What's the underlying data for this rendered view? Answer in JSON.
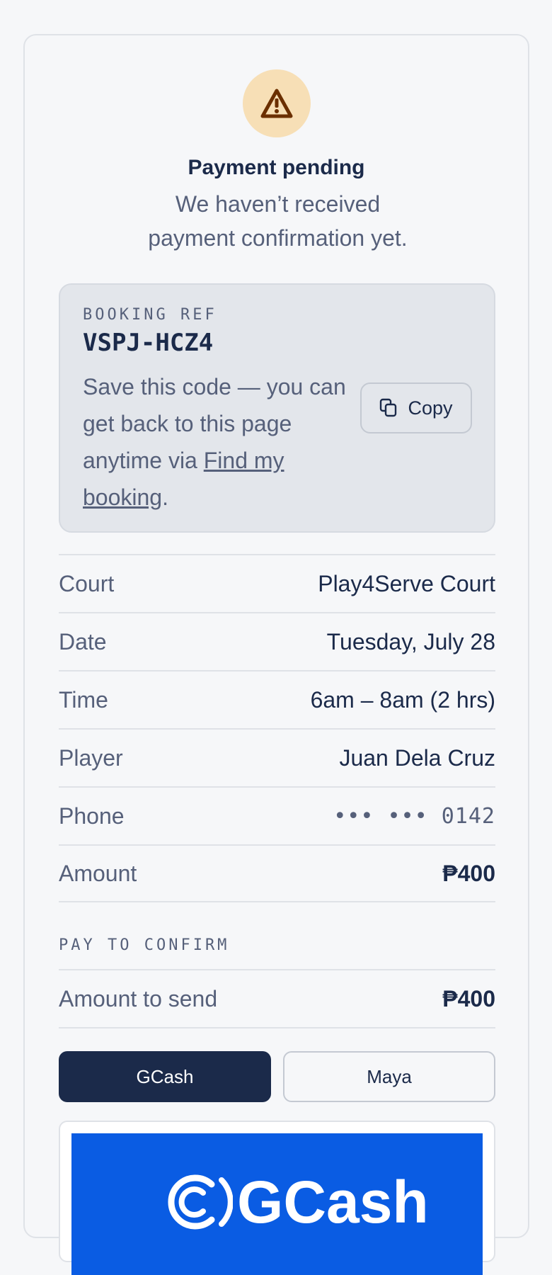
{
  "status": {
    "title": "Payment pending",
    "message": "We haven’t received payment confirmation yet."
  },
  "booking_ref": {
    "label": "BOOKING REF",
    "code": "VSPJ-HCZ4",
    "note_prefix": "Save this code — you can get back to this page anytime via ",
    "link_text": "Find my booking",
    "note_suffix": ".",
    "copy_label": "Copy"
  },
  "details": [
    {
      "label": "Court",
      "value": "Play4Serve Court"
    },
    {
      "label": "Date",
      "value": "Tuesday, July 28"
    },
    {
      "label": "Time",
      "value": "6am – 8am (2 hrs)"
    },
    {
      "label": "Player",
      "value": "Juan Dela Cruz"
    },
    {
      "label": "Phone",
      "value": "••• ••• 0142"
    },
    {
      "label": "Amount",
      "value": "₱400"
    }
  ],
  "payment": {
    "section_label": "PAY TO CONFIRM",
    "amount_label": "Amount to send",
    "amount_value": "₱400",
    "methods": [
      "GCash",
      "Maya"
    ],
    "selected_method": "GCash",
    "banner_logo_text": "GCash"
  },
  "colors": {
    "primary": "#1b2a4a",
    "warning_bg": "#f7dfb6",
    "warning_icon": "#6b2f00",
    "gcash_blue": "#0a5ce3"
  },
  "icons": {
    "status": "warning-triangle-icon",
    "copy": "copy-icon"
  }
}
